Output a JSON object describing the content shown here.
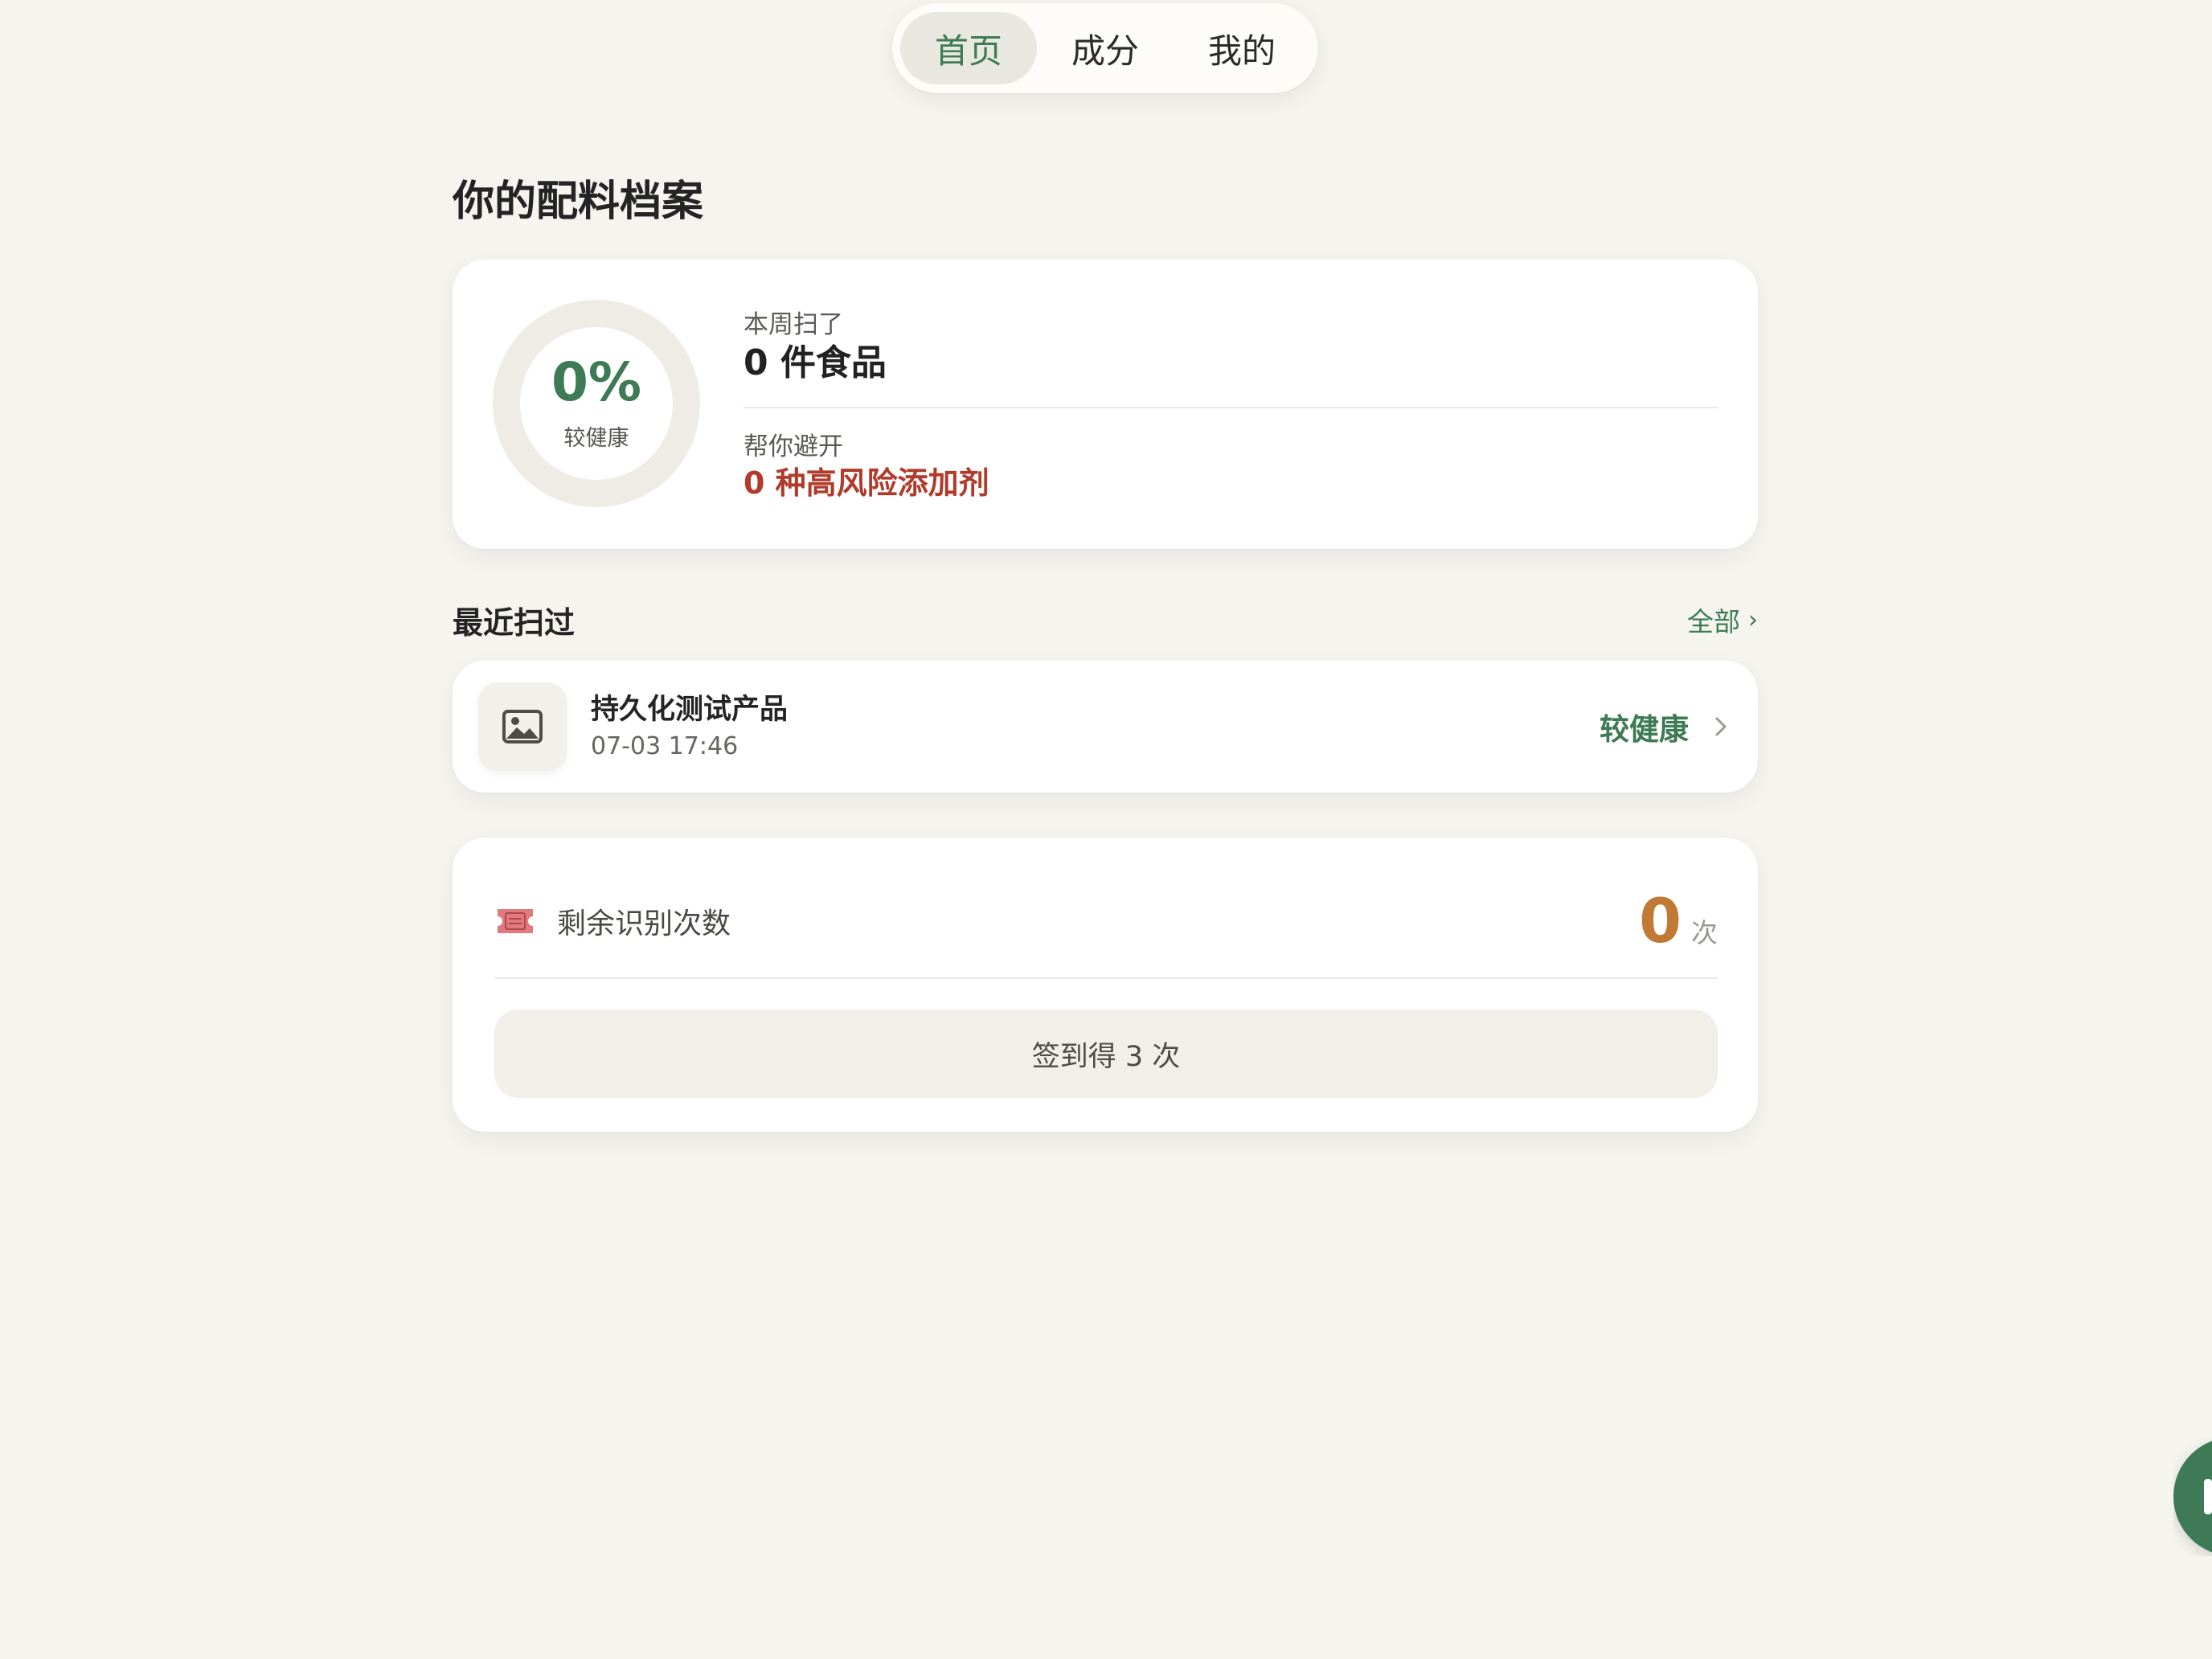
{
  "nav": {
    "tabs": [
      {
        "label": "首页",
        "active": true
      },
      {
        "label": "成分",
        "active": false
      },
      {
        "label": "我的",
        "active": false
      }
    ]
  },
  "page": {
    "title": "你的配料档案"
  },
  "stats": {
    "health_percent": "0%",
    "health_label": "较健康",
    "week_label": "本周扫了",
    "week_value": "0 件食品",
    "avoid_label": "帮你避开",
    "avoid_value": "0 种高风险添加剂"
  },
  "recent": {
    "title": "最近扫过",
    "see_all": "全部",
    "items": [
      {
        "thumb_icon": "image-icon",
        "name": "持久化测试产品",
        "time": "07-03 17:46",
        "status": "较健康"
      }
    ]
  },
  "credits": {
    "icon": "ticket-icon",
    "label": "剩余识别次数",
    "count": "0",
    "unit": "次",
    "checkin_label": "签到得 3 次"
  },
  "colors": {
    "background": "#f5f4ef",
    "accent_green": "#3d7a55",
    "risk_red": "#b03b2b",
    "count_orange": "#c07a35"
  }
}
